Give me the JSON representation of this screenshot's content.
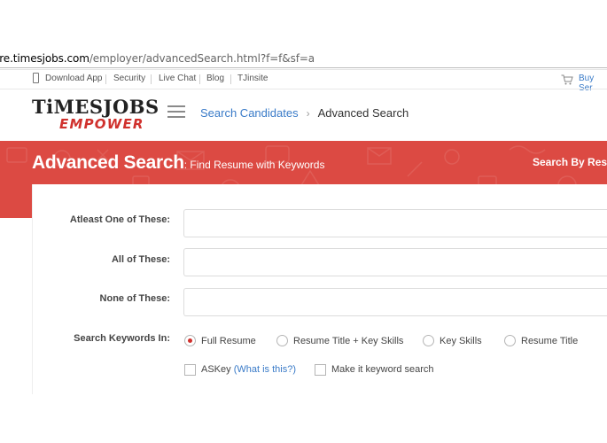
{
  "browser": {
    "url_domain": "ire.timesjobs.com",
    "url_path": "/employer/advancedSearch.html?f=f&sf=a"
  },
  "toplinks": {
    "items": [
      "Download App",
      "Security",
      "Live Chat",
      "Blog",
      "TJinsite"
    ],
    "buy": "Buy Ser"
  },
  "header": {
    "logo_top_left": "TiMES",
    "logo_top_right": "JOBS",
    "logo_bottom": "EMPOWER",
    "breadcrumb_link": "Search Candidates",
    "breadcrumb_current": "Advanced Search"
  },
  "banner": {
    "title": "Advanced Search",
    "subtitle": ": Find Resume with Keywords",
    "right_link": "Search By Resu"
  },
  "form": {
    "atleast_label": "Atleast One of These:",
    "atleast_value": "",
    "all_label": "All of These:",
    "all_value": "",
    "none_label": "None of These:",
    "none_value": "",
    "search_in_label": "Search Keywords In:",
    "radio_options": [
      "Full Resume",
      "Resume Title + Key Skills",
      "Key Skills",
      "Resume Title"
    ],
    "radio_selected": "Full Resume",
    "askey_label": "ASKey",
    "askey_help": "(What is this?)",
    "keyword_search_label": "Make it keyword search"
  },
  "colors": {
    "brand_red": "#dc4a43",
    "link_blue": "#3a7bc8"
  }
}
